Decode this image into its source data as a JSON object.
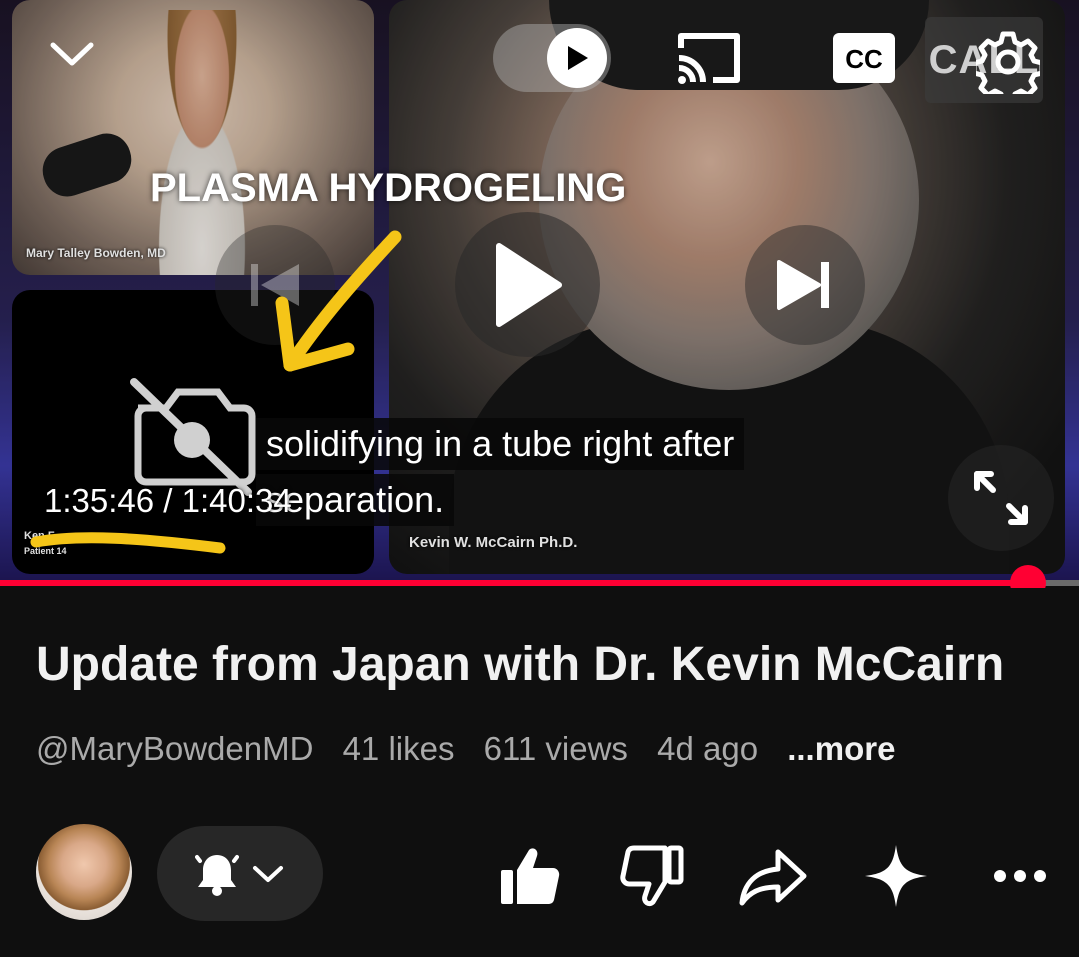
{
  "player": {
    "overlay_caption": "PLASMA HYDROGELING",
    "guest_name": "Mary Talley Bowden, MD",
    "offcam_name": "Ken F",
    "offcam_sub": "Patient 14",
    "speaker_name": "Kevin W. McCairn Ph.D.",
    "subtitle_line1": "solidifying in a tube right after",
    "subtitle_line2": "separation.",
    "time_display": "1:35:46 / 1:40:34",
    "channel_logo": "CALL",
    "progress_fraction": 0.953,
    "controls": [
      "collapse-icon",
      "autoplay-toggle",
      "cast-icon",
      "cc-icon",
      "settings-icon",
      "previous-icon",
      "play-icon",
      "next-icon",
      "fullscreen-icon"
    ]
  },
  "video": {
    "title": "Update from Japan with Dr. Kevin McCairn",
    "channel_handle": "@MaryBowdenMD",
    "likes": "41 likes",
    "views": "611 views",
    "age": "4d ago",
    "more": "...more"
  },
  "actions": [
    "bell-icon",
    "like-icon",
    "dislike-icon",
    "share-icon",
    "sparkle-icon",
    "more-icon"
  ],
  "colors": {
    "accent": "#ff0033",
    "background": "#0f0f0f",
    "annotation": "#f5c518"
  }
}
